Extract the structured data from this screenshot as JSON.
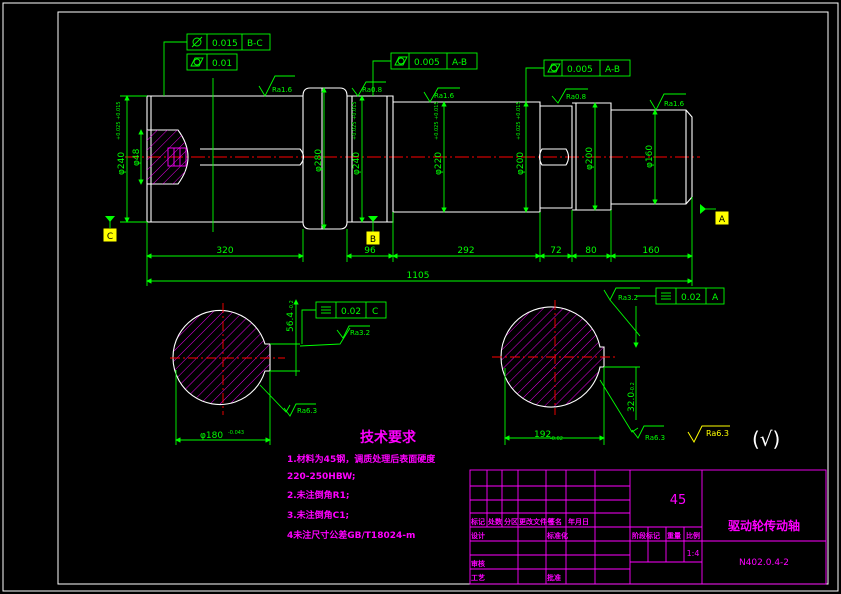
{
  "colors": {
    "background": "#000000",
    "outline": "#ffffff",
    "dimension": "#00ff00",
    "centerline": "#ff0000",
    "hatch": "#ff00ff",
    "text": "#ff00ff",
    "datum_fill": "#ffff00"
  },
  "dims": {
    "d_main": "1105",
    "d_320": "320",
    "d_96": "96",
    "d_292": "292",
    "d_72": "72",
    "d_80": "80",
    "d_160": "160",
    "phi240_left": "φ240",
    "phi280": "φ280",
    "phi240_mid": "φ240",
    "phi220": "φ220",
    "phi200": "φ200",
    "phi160": "φ160",
    "phi_small": "φ48",
    "dia_left_sec": "φ180",
    "dia_left_sec_tol": "-0.043",
    "key_left": "56.4",
    "key_left_tol": "-0.2",
    "key_right": "32.0",
    "key_right_tol": "-0.2",
    "dia_right_sec": "192",
    "dia_right_sec_tol": "-0.02",
    "tol_small": "+0.025 +0.015"
  },
  "gdt": {
    "runout_top": {
      "value": "0.015",
      "ref": "B-C"
    },
    "cyl_top": {
      "value": "0.01"
    },
    "cyl_mid": {
      "value": "0.005",
      "ref": "A-B"
    },
    "cyl_right": {
      "value": "0.005",
      "ref": "A-B"
    },
    "sym_left": {
      "value": "0.02",
      "ref": "C"
    },
    "sym_right": {
      "value": "0.02",
      "ref": "A"
    }
  },
  "datums": {
    "c": "C",
    "b": "B",
    "a": "A"
  },
  "roughness": {
    "r1": "Ra1.6",
    "r2": "Ra0.8",
    "r3": "Ra1.6",
    "r4": "Ra0.8",
    "r5": "Ra1.6",
    "r6": "Ra3.2",
    "r7": "Ra6.3",
    "r8": "Ra3.2",
    "r9": "Ra6.3",
    "r_general": "Ra6.3",
    "r_paren": "(√)"
  },
  "notes": {
    "title": "技术要求",
    "line1": "1.材料为45钢，调质处理后表面硬度",
    "line2": "220-250HBW;",
    "line3": "2.未注倒角R1;",
    "line4": "3.未注倒角C1;",
    "line5": "4未注尺寸公差GB/T18024-m"
  },
  "titleblock": {
    "material": "45",
    "part_name": "驱动轮传动轴",
    "drawing_no": "N402.0.4-2",
    "scale": "1:4",
    "h_mark": "标记",
    "h_qty": "处数",
    "h_zone": "分区",
    "h_doc": "更改文件号",
    "h_sign": "签名",
    "h_date": "年月日",
    "h_design": "设计",
    "h_std": "标准化",
    "h_stage": "阶段标记",
    "h_weight": "重量",
    "h_ratio": "比例",
    "h_check": "审核",
    "h_process": "工艺",
    "h_approve": "批准"
  }
}
